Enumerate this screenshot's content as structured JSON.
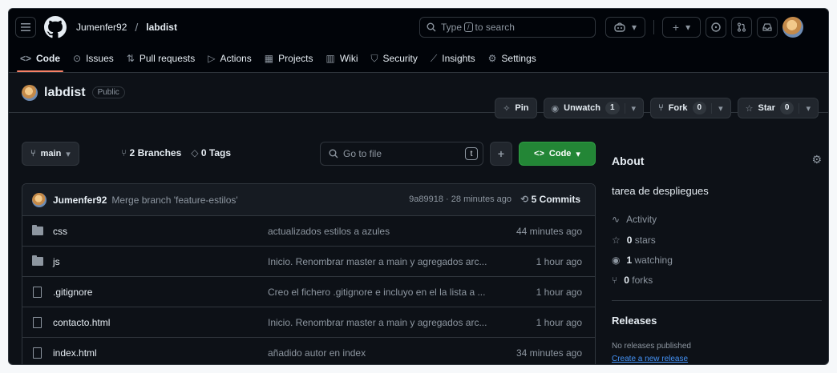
{
  "header": {
    "owner": "Jumenfer92",
    "separator": "/",
    "repo": "labdist",
    "search_pre": "Type",
    "search_key": "/",
    "search_post": "to search",
    "plus": "+",
    "dropdown": "▾"
  },
  "tabs": [
    {
      "label": "Code",
      "icon": "<>"
    },
    {
      "label": "Issues",
      "icon": "⊙"
    },
    {
      "label": "Pull requests",
      "icon": "⇅"
    },
    {
      "label": "Actions",
      "icon": "▷"
    },
    {
      "label": "Projects",
      "icon": "▦"
    },
    {
      "label": "Wiki",
      "icon": "▥"
    },
    {
      "label": "Security",
      "icon": "⛉"
    },
    {
      "label": "Insights",
      "icon": "⟋"
    },
    {
      "label": "Settings",
      "icon": "⚙"
    }
  ],
  "repo_header": {
    "name": "labdist",
    "visibility": "Public",
    "pin": "Pin",
    "unwatch": "Unwatch",
    "watch_count": "1",
    "fork": "Fork",
    "fork_count": "0",
    "star": "Star",
    "star_count": "0"
  },
  "toolbar": {
    "branch": "main",
    "branches_count": "2",
    "branches_label": "Branches",
    "tags_count": "0",
    "tags_label": "Tags",
    "go_to_file": "Go to file",
    "go_to_file_key": "t",
    "code_button": "Code"
  },
  "latest_commit": {
    "author": "Jumenfer92",
    "message": "Merge branch 'feature-estilos'",
    "meta": "9a89918 · 28 minutes ago",
    "commits_count": "5 Commits"
  },
  "files": [
    {
      "name": "css",
      "type": "folder",
      "message": "actualizados estilos a azules",
      "time": "44 minutes ago"
    },
    {
      "name": "js",
      "type": "folder",
      "message": "Inicio. Renombrar master a main y agregados arc...",
      "time": "1 hour ago"
    },
    {
      "name": ".gitignore",
      "type": "file",
      "message": "Creo el fichero .gitignore e incluyo en el la lista a ...",
      "time": "1 hour ago"
    },
    {
      "name": "contacto.html",
      "type": "file",
      "message": "Inicio. Renombrar master a main y agregados arc...",
      "time": "1 hour ago"
    },
    {
      "name": "index.html",
      "type": "file",
      "message": "añadido autor en index",
      "time": "34 minutes ago"
    }
  ],
  "about": {
    "title": "About",
    "description": "tarea de despliegues",
    "activity": "Activity",
    "stars_count": "0",
    "stars_label": "stars",
    "watching_count": "1",
    "watching_label": "watching",
    "forks_count": "0",
    "forks_label": "forks"
  },
  "releases": {
    "title": "Releases",
    "none": "No releases published",
    "create_link": "Create a new release"
  },
  "colors": {
    "background": "#0d1117",
    "header": "#010409",
    "accent_tab": "#f78166",
    "primary_button": "#238636",
    "link": "#4493f8"
  }
}
